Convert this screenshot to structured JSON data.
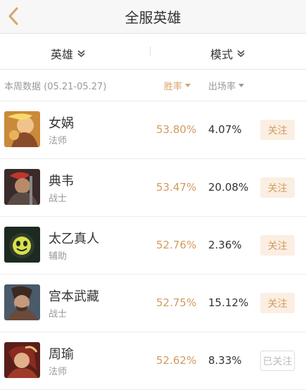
{
  "header": {
    "title": "全服英雄"
  },
  "filters": {
    "hero_label": "英雄",
    "mode_label": "模式"
  },
  "week": {
    "text": "本周数据 (05.21-05.27)",
    "win_label": "胜率",
    "pick_label": "出场率"
  },
  "colors": {
    "accent": "#d29b5d",
    "follow_bg": "#fbeee2",
    "muted": "#999999"
  },
  "heroes": [
    {
      "name": "女娲",
      "role": "法师",
      "win_rate": "53.80%",
      "pick_rate": "4.07%",
      "follow_label": "关注",
      "followed": false
    },
    {
      "name": "典韦",
      "role": "战士",
      "win_rate": "53.47%",
      "pick_rate": "20.08%",
      "follow_label": "关注",
      "followed": false
    },
    {
      "name": "太乙真人",
      "role": "辅助",
      "win_rate": "52.76%",
      "pick_rate": "2.36%",
      "follow_label": "关注",
      "followed": false
    },
    {
      "name": "宫本武藏",
      "role": "战士",
      "win_rate": "52.75%",
      "pick_rate": "15.12%",
      "follow_label": "关注",
      "followed": false
    },
    {
      "name": "周瑜",
      "role": "法师",
      "win_rate": "52.62%",
      "pick_rate": "8.33%",
      "follow_label": "已关注",
      "followed": true
    }
  ]
}
